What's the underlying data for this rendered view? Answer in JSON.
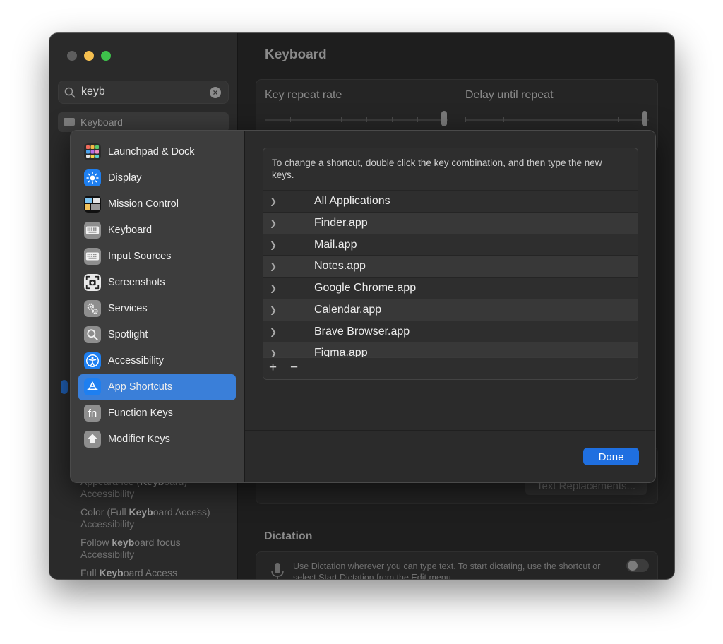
{
  "window": {
    "title": "Keyboard"
  },
  "sidebar": {
    "search_value": "keyb",
    "selected_item": "Keyboard",
    "results": [
      {
        "pre": "Appearance (",
        "hl": "Keyb",
        "post": "oard)",
        "section": "Accessibility"
      },
      {
        "pre": "Color (Full ",
        "hl": "Keyb",
        "post": "oard Access)",
        "section": "Accessibility"
      },
      {
        "pre": "Follow ",
        "hl": "keyb",
        "post": "oard focus",
        "section": "Accessibility"
      },
      {
        "pre": "Full ",
        "hl": "Keyb",
        "post": "oard Access",
        "section": ""
      }
    ]
  },
  "main": {
    "key_repeat_label": "Key repeat rate",
    "delay_label": "Delay until repeat",
    "text_replacements_label": "Text Replacements...",
    "dictation_title": "Dictation",
    "dictation_text": "Use Dictation wherever you can type text. To start dictating, use the shortcut or select Start Dictation from the Edit menu."
  },
  "sheet": {
    "nav": [
      {
        "label": "Launchpad & Dock",
        "icon": "launchpad-icon"
      },
      {
        "label": "Display",
        "icon": "display-icon"
      },
      {
        "label": "Mission Control",
        "icon": "mission-control-icon"
      },
      {
        "label": "Keyboard",
        "icon": "keyboard-icon"
      },
      {
        "label": "Input Sources",
        "icon": "input-sources-icon"
      },
      {
        "label": "Screenshots",
        "icon": "screenshot-icon"
      },
      {
        "label": "Services",
        "icon": "services-icon"
      },
      {
        "label": "Spotlight",
        "icon": "spotlight-icon"
      },
      {
        "label": "Accessibility",
        "icon": "accessibility-icon"
      },
      {
        "label": "App Shortcuts",
        "icon": "app-shortcuts-icon",
        "selected": true
      },
      {
        "label": "Function Keys",
        "icon": "function-keys-icon"
      },
      {
        "label": "Modifier Keys",
        "icon": "modifier-keys-icon"
      }
    ],
    "hint": "To change a shortcut, double click the key combination, and then type the new keys.",
    "apps": [
      "All Applications",
      "Finder.app",
      "Mail.app",
      "Notes.app",
      "Google Chrome.app",
      "Calendar.app",
      "Brave Browser.app",
      "Figma.app"
    ],
    "add_label": "+",
    "remove_label": "−",
    "done_label": "Done"
  },
  "colors": {
    "accent": "#3a7fd9",
    "done": "#1f6fe0"
  }
}
